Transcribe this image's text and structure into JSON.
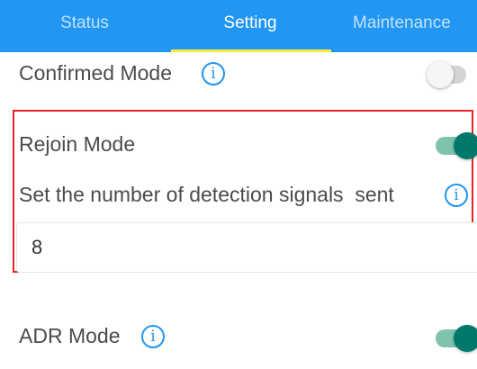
{
  "tabs": [
    {
      "label": "Status",
      "active": false
    },
    {
      "label": "Setting",
      "active": true
    },
    {
      "label": "Maintenance",
      "active": false
    }
  ],
  "settings": {
    "confirmed_mode": {
      "label": "Confirmed Mode",
      "enabled": false
    },
    "rejoin_mode": {
      "label": "Rejoin Mode",
      "enabled": true
    },
    "detection_signals": {
      "label": "Set the number of detection signals  sent",
      "value": "8"
    },
    "adr_mode": {
      "label": "ADR Mode",
      "enabled": true
    }
  },
  "icons": {
    "info": "info-icon"
  },
  "colors": {
    "tab_bar": "#2196f3",
    "tab_indicator": "#ffeb3b",
    "toggle_on": "#00796b",
    "toggle_on_track": "#7fc2ad",
    "toggle_off_track": "#d5d5d5",
    "highlight_border": "#e82424",
    "info_icon": "#2196f3"
  },
  "info_glyph": "i"
}
